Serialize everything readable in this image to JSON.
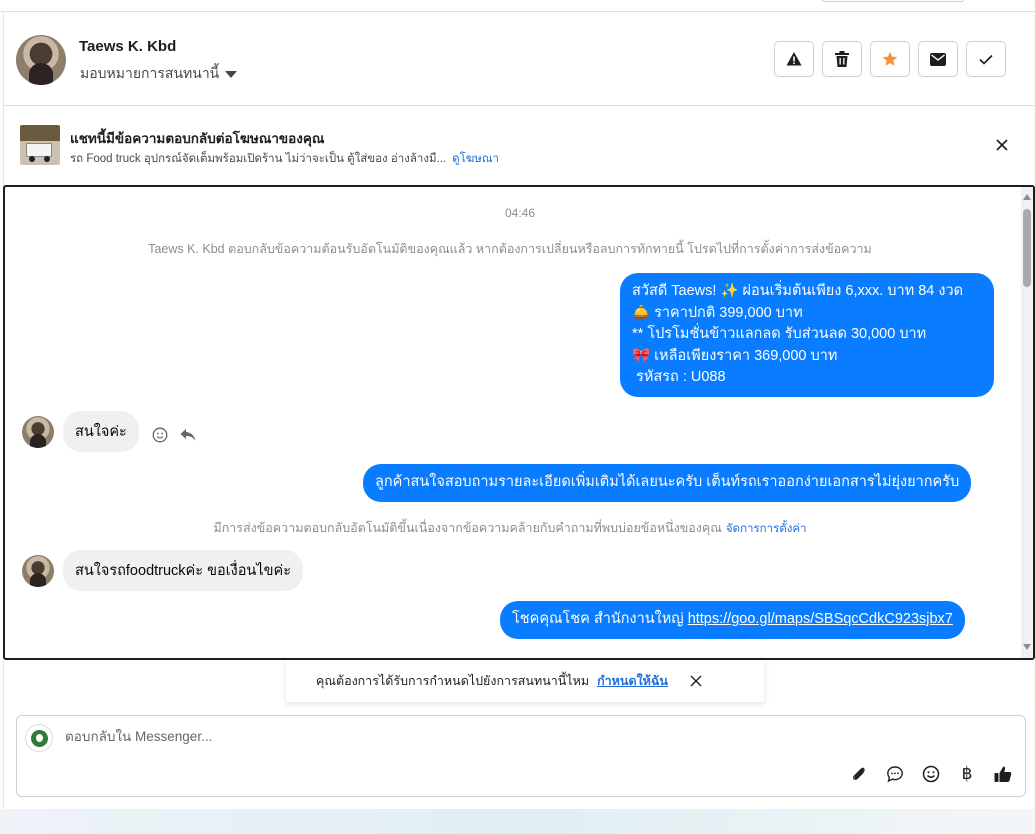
{
  "contact": {
    "name": "Taews K. Kbd",
    "assign_label": "มอบหมายการสนทนานี้"
  },
  "actions": [
    {
      "name": "report-spam-button",
      "icon": "warning-icon"
    },
    {
      "name": "delete-button",
      "icon": "trash-icon"
    },
    {
      "name": "star-button",
      "icon": "star-icon",
      "color": "#f7923b"
    },
    {
      "name": "mark-unread-button",
      "icon": "envelope-icon"
    },
    {
      "name": "mark-done-button",
      "icon": "check-icon"
    }
  ],
  "ad_banner": {
    "title": "แชทนี้มีข้อความตอบกลับต่อโฆษณาของคุณ",
    "description": "รถ Food truck อุปกรณ์จัดเต็มพร้อมเปิดร้าน ไม่ว่าจะเป็น ตู้ใส่ของ อ่างล้างมื...",
    "link": "ดูโฆษณา"
  },
  "chat": {
    "timestamp": "04:46",
    "auto_reply_note": "Taews K. Kbd ตอบกลับข้อความต้อนรับอัตโนมัติของคุณแล้ว หากต้องการเปลี่ยนหรือลบการทักทายนี้ โปรดไปที่การตั้งค่าการส่งข้อความ",
    "greeting_lines": [
      "สวัสดี Taews! ✨  ผ่อนเริ่มต้นเพียง 6,xxx. บาท 84 งวด",
      "🛎️ ราคาปกติ 399,000 บาท",
      "** โปรโมชั่นข้าวแลกลด รับส่วนลด 30,000 บาท",
      "🎀  เหลือเพียงราคา 369,000 บาท",
      " รหัสรถ : U088"
    ],
    "customer_msg_1": "สนใจค่ะ",
    "reply_1": "ลูกค้าสนใจสอบถามรายละเอียดเพิ่มเติมได้เลยนะครับ เต็นท์รถเราออกง่ายเอกสารไม่ยุ่งยากครับ",
    "faq_note": "มีการส่งข้อความตอบกลับอัตโนมัติขึ้นเนื่องจากข้อความคล้ายกับคำถามที่พบบ่อยข้อหนึ่งของคุณ",
    "faq_link": "จัดการการตั้งค่า",
    "customer_msg_2": "สนใจรถfoodtruckค่ะ ขอเงื่อนไขค่ะ",
    "reply_2_prefix": "โชคคุณโชค สำนักงานใหญ่ ",
    "reply_2_link": "https://goo.gl/maps/SBSqcCdkC923sjbx7"
  },
  "assign_prompt": {
    "text": "คุณต้องการได้รับการกำหนดไปยังการสนทนานี้ไหม",
    "link": "กำหนดให้ฉัน"
  },
  "composer": {
    "placeholder": "ตอบกลับใน Messenger...",
    "tools": [
      "paperclip-icon",
      "chat-bubble-icon",
      "emoji-icon",
      "baht-icon",
      "thumbs-up-icon"
    ],
    "baht_symbol": "฿"
  },
  "colors": {
    "outgoing_bubble": "#0a7cff",
    "incoming_bubble": "#f0f0f0",
    "link": "#216fdb",
    "star": "#f7923b"
  }
}
